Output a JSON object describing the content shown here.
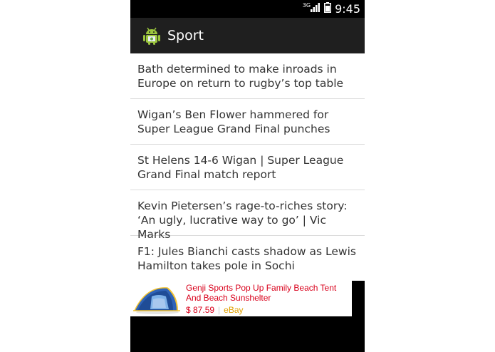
{
  "status_bar": {
    "network": "3G",
    "time": "9:45"
  },
  "action_bar": {
    "title": "Sport",
    "icon": "android-app-icon"
  },
  "articles": [
    {
      "title": "Bath determined to make inroads in Europe on return to rugby’s top table"
    },
    {
      "title": "Wigan’s Ben Flower hammered for Super League Grand Final punches"
    },
    {
      "title": "St Helens 14-6 Wigan | Super League Grand Final match report"
    },
    {
      "title": "Kevin Pietersen’s rage-to-riches story: ‘An ugly, lucrative way to go’ | Vic Marks"
    },
    {
      "title": "F1: Jules Bianchi casts shadow as Lewis Hamilton takes pole in Sochi"
    }
  ],
  "ad": {
    "title": "Genji Sports Pop Up Family Beach Tent And Beach Sunshelter",
    "price": "$ 87.59",
    "separator": "|",
    "source": "eBay",
    "image": "beach-tent-image"
  },
  "colors": {
    "action_bar": "#1f1f1f",
    "status_bar": "#000000",
    "ad_accent": "#d9001b",
    "ad_source": "#e0a000"
  }
}
